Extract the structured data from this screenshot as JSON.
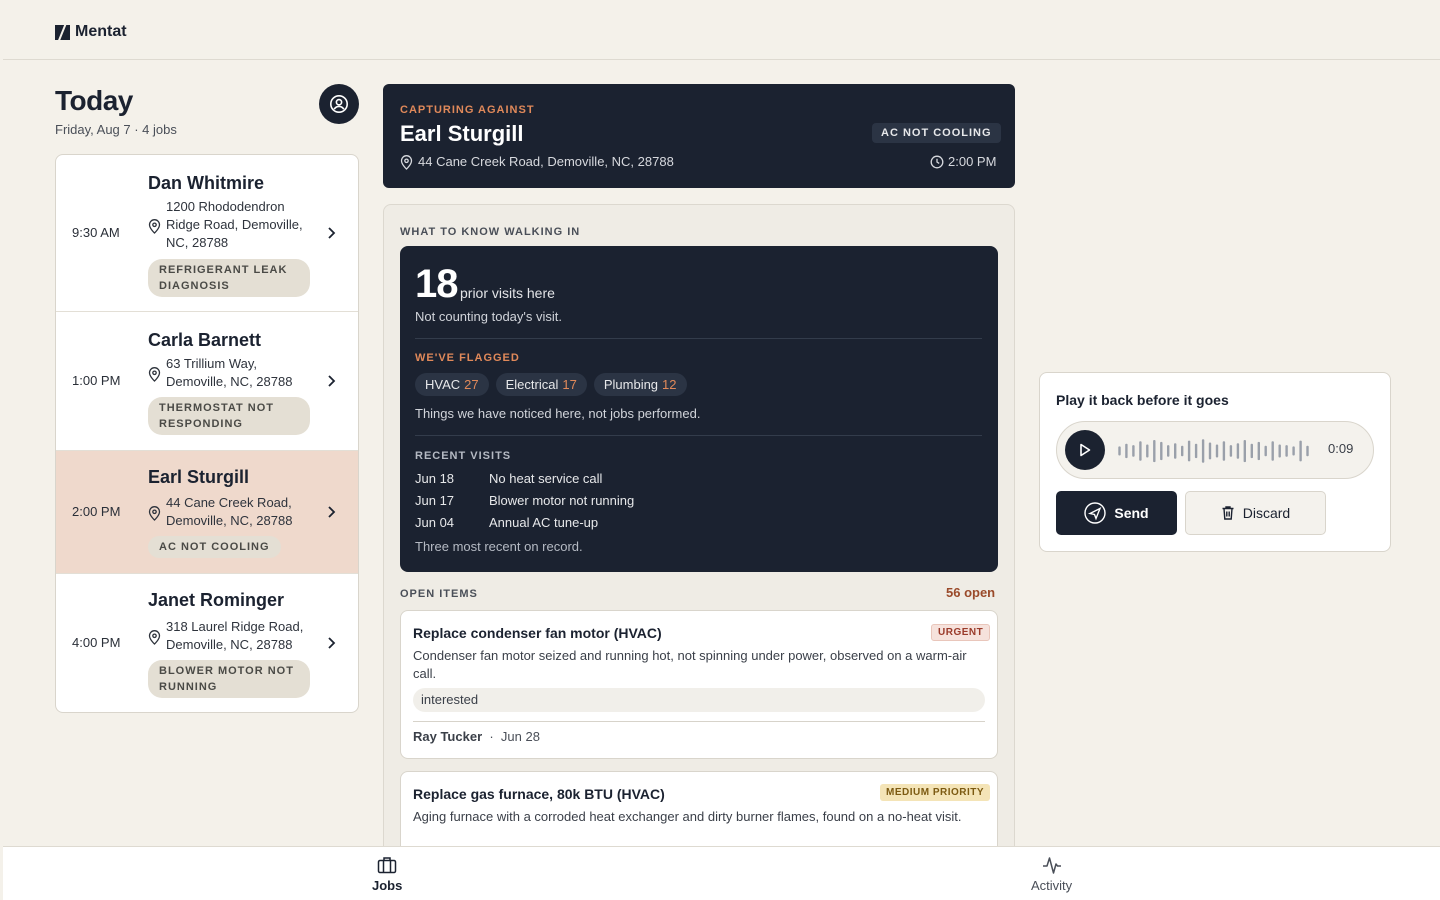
{
  "app": {
    "name": "Mentat"
  },
  "today": {
    "title": "Today",
    "subtitle": "Friday, Aug 7 · 4 jobs"
  },
  "jobs": [
    {
      "time": "9:30 AM",
      "name": "Dan Whitmire",
      "address": "1200 Rhododendron Ridge Road, Demoville, NC, 28788",
      "tag": "REFRIGERANT LEAK DIAGNOSIS"
    },
    {
      "time": "1:00 PM",
      "name": "Carla Barnett",
      "address": "63 Trillium Way, Demoville, NC, 28788",
      "tag": "THERMOSTAT NOT RESPONDING"
    },
    {
      "time": "2:00 PM",
      "name": "Earl Sturgill",
      "address": "44 Cane Creek Road, Demoville, NC, 28788",
      "tag": "AC NOT COOLING",
      "active": true
    },
    {
      "time": "4:00 PM",
      "name": "Janet Rominger",
      "address": "318 Laurel Ridge Road, Demoville, NC, 28788",
      "tag": "BLOWER MOTOR NOT RUNNING"
    }
  ],
  "header": {
    "label": "CAPTURING AGAINST",
    "name": "Earl Sturgill",
    "address": "44 Cane Creek Road, Demoville, NC, 28788",
    "badge": "AC NOT COOLING",
    "time": "2:00 PM"
  },
  "know": {
    "label": "WHAT TO KNOW WALKING IN",
    "visits_count": "18",
    "visits_text": "prior visits here",
    "visits_note": "Not counting today's visit.",
    "flag_label": "WE'VE FLAGGED",
    "flags": [
      {
        "name": "HVAC",
        "count": "27"
      },
      {
        "name": "Electrical",
        "count": "17"
      },
      {
        "name": "Plumbing",
        "count": "12"
      }
    ],
    "flag_note": "Things we have noticed here, not jobs performed.",
    "recent_label": "RECENT VISITS",
    "recent": [
      {
        "date": "Jun 18",
        "desc": "No heat service call"
      },
      {
        "date": "Jun 17",
        "desc": "Blower motor not running"
      },
      {
        "date": "Jun 04",
        "desc": "Annual AC tune-up"
      }
    ],
    "recent_note": "Three most recent on record."
  },
  "open_items": {
    "label": "OPEN ITEMS",
    "count": "56 open",
    "items": [
      {
        "title": "Replace condenser fan motor (HVAC)",
        "priority": "URGENT",
        "desc": "Condenser fan motor seized and running hot, not spinning under power, observed on a warm-air call.",
        "status": "interested",
        "author": "Ray Tucker",
        "date": "Jun 28"
      },
      {
        "title": "Replace gas furnace, 80k BTU (HVAC)",
        "priority": "MEDIUM PRIORITY",
        "desc": "Aging furnace with a corroded heat exchanger and dirty burner flames, found on a no-heat visit."
      }
    ]
  },
  "playback": {
    "title": "Play it back before it goes",
    "duration": "0:09",
    "waveform": [
      0.35,
      0.55,
      0.45,
      0.75,
      0.5,
      0.85,
      0.7,
      0.45,
      0.6,
      0.4,
      0.8,
      0.55,
      0.9,
      0.65,
      0.5,
      0.75,
      0.45,
      0.6,
      0.85,
      0.55,
      0.7,
      0.4,
      0.75,
      0.5,
      0.45,
      0.35,
      0.8,
      0.4
    ],
    "send": "Send",
    "discard": "Discard"
  },
  "tabs": {
    "jobs": "Jobs",
    "activity": "Activity"
  },
  "colors": {
    "navy": "#1b2230",
    "accent": "#e0895a",
    "active_row": "#efd9cc",
    "bg": "#f4f1ea"
  }
}
